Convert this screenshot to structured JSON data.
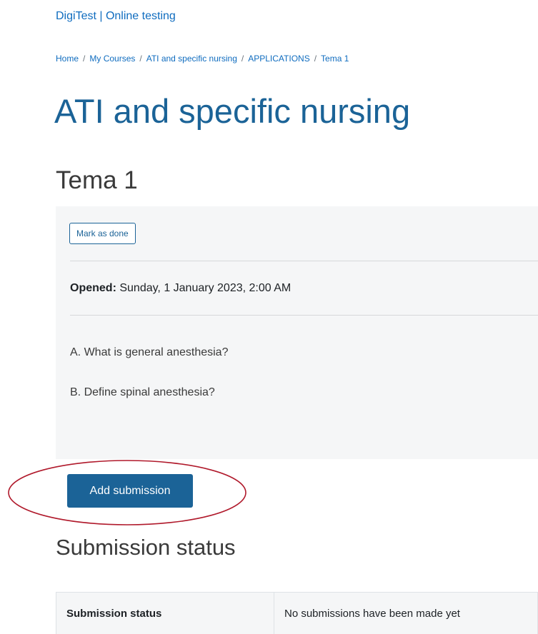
{
  "header": {
    "site_name": "DigiTest | Online testing"
  },
  "breadcrumb": {
    "items": [
      "Home",
      "My Courses",
      "ATI and specific nursing",
      "APPLICATIONS",
      "Tema 1"
    ],
    "separator": "/"
  },
  "course": {
    "title": "ATI and specific nursing"
  },
  "activity": {
    "title": "Tema 1",
    "mark_done_label": "Mark as done",
    "opened_label": "Opened:",
    "opened_value": "Sunday, 1 January 2023, 2:00 AM",
    "questions": [
      "A. What is general anesthesia?",
      "B. Define spinal anesthesia?"
    ]
  },
  "actions": {
    "add_submission_label": "Add submission"
  },
  "submission": {
    "heading": "Submission status",
    "rows": [
      {
        "label": "Submission status",
        "value": "No submissions have been made yet"
      }
    ]
  },
  "colors": {
    "accent": "#1b6397",
    "link": "#0f6cbf",
    "annotation": "#b0192b"
  }
}
